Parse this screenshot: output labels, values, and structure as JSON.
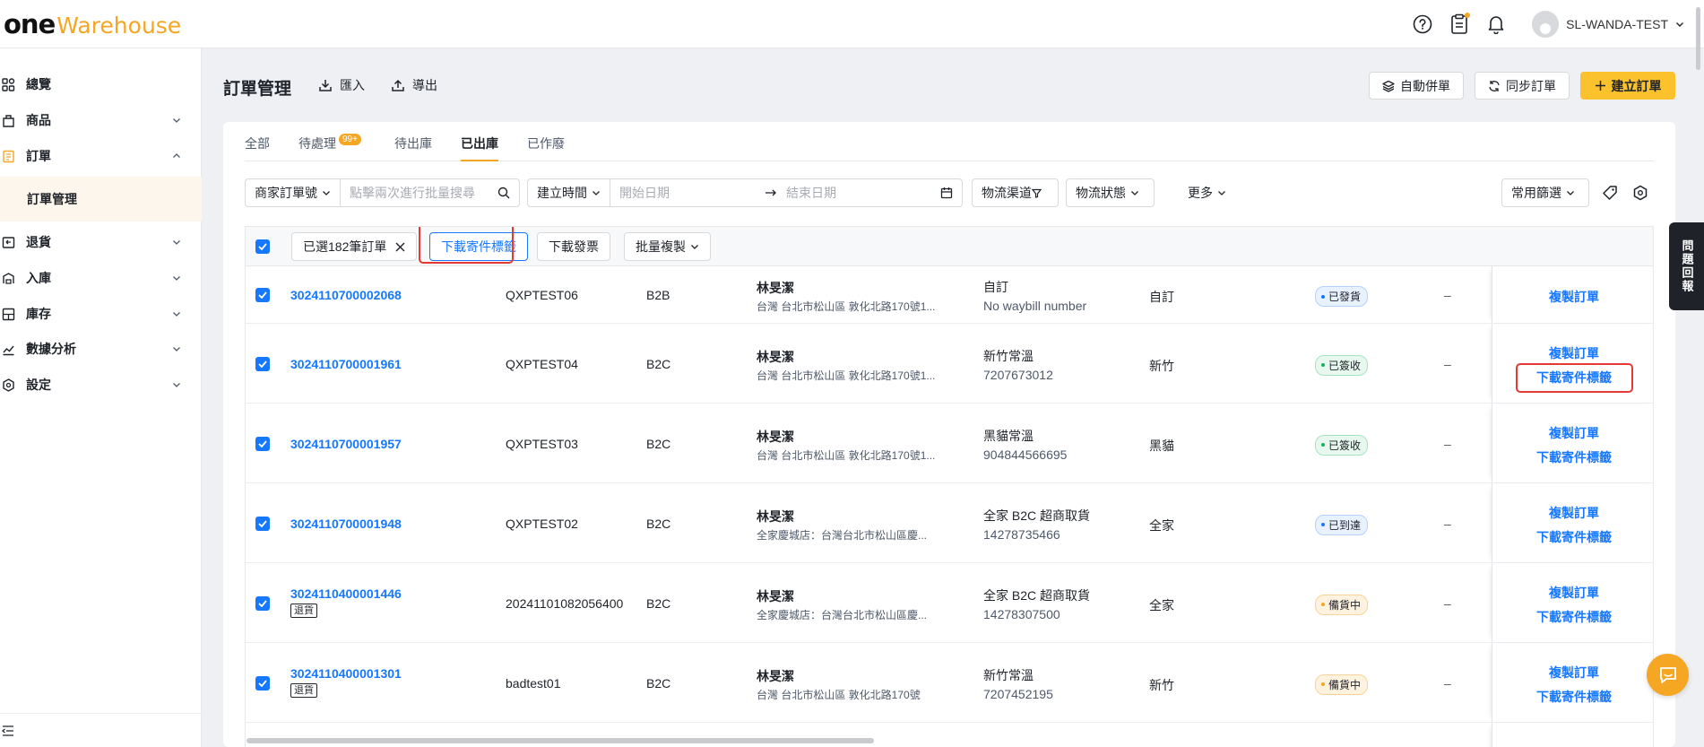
{
  "brand": {
    "part1": "one",
    "part2": "Warehouse"
  },
  "header": {
    "user_name": "SL-WANDA-TEST"
  },
  "sidebar": {
    "items": [
      {
        "label": "總覽",
        "icon": "dashboard-icon"
      },
      {
        "label": "商品",
        "icon": "product-icon"
      },
      {
        "label": "訂單",
        "icon": "order-icon"
      },
      {
        "label": "退貨",
        "icon": "return-icon"
      },
      {
        "label": "入庫",
        "icon": "inbound-icon"
      },
      {
        "label": "庫存",
        "icon": "inventory-icon"
      },
      {
        "label": "數據分析",
        "icon": "analytics-icon"
      },
      {
        "label": "設定",
        "icon": "settings-icon"
      }
    ],
    "active_sub": "訂單管理"
  },
  "page": {
    "title": "訂單管理",
    "import_label": "匯入",
    "export_label": "導出",
    "auto_merge_label": "自動併單",
    "sync_label": "同步訂單",
    "create_label": "建立訂單"
  },
  "tabs": [
    {
      "label": "全部"
    },
    {
      "label": "待處理",
      "badge": "99+"
    },
    {
      "label": "待出庫"
    },
    {
      "label": "已出庫"
    },
    {
      "label": "已作廢"
    }
  ],
  "filters": {
    "order_field": "商家訂單號",
    "search_placeholder": "點擊兩次進行批量搜尋",
    "time_field": "建立時間",
    "start_placeholder": "開始日期",
    "end_placeholder": "結束日期",
    "logistics_channel": "物流渠道",
    "logistics_status": "物流狀態",
    "more": "更多",
    "common_filter": "常用篩選"
  },
  "bulk": {
    "selected": "已選182筆訂單",
    "download_label": "下載寄件標籤",
    "download_invoice": "下載發票",
    "batch_copy": "批量複製"
  },
  "rows": [
    {
      "order_no": "3024110700002068",
      "merchant_no": "QXPTEST06",
      "type": "B2B",
      "name": "林旻潔",
      "addr": "台灣 台北市松山區 敦化北路170號1...",
      "ship_method": "自訂",
      "tracking": "No waybill number",
      "carrier": "自訂",
      "status": "已發貨",
      "status_color": "blue",
      "dash": "–",
      "actions": [
        "複製訂單"
      ],
      "returned": false
    },
    {
      "order_no": "3024110700001961",
      "merchant_no": "QXPTEST04",
      "type": "B2C",
      "name": "林旻潔",
      "addr": "台灣 台北市松山區 敦化北路170號1...",
      "ship_method": "新竹常溫",
      "tracking": "7207673012",
      "carrier": "新竹",
      "status": "已簽收",
      "status_color": "green",
      "dash": "–",
      "actions": [
        "複製訂單",
        "下載寄件標籤"
      ],
      "returned": false
    },
    {
      "order_no": "3024110700001957",
      "merchant_no": "QXPTEST03",
      "type": "B2C",
      "name": "林旻潔",
      "addr": "台灣 台北市松山區 敦化北路170號1...",
      "ship_method": "黑貓常溫",
      "tracking": "904844566695",
      "carrier": "黑貓",
      "status": "已簽收",
      "status_color": "green",
      "dash": "–",
      "actions": [
        "複製訂單",
        "下載寄件標籤"
      ],
      "returned": false
    },
    {
      "order_no": "3024110700001948",
      "merchant_no": "QXPTEST02",
      "type": "B2C",
      "name": "林旻潔",
      "addr": "全家慶城店：台灣台北市松山區慶...",
      "ship_method": "全家 B2C 超商取貨",
      "tracking": "14278735466",
      "carrier": "全家",
      "status": "已到達",
      "status_color": "blue",
      "dash": "–",
      "actions": [
        "複製訂單",
        "下載寄件標籤"
      ],
      "returned": false
    },
    {
      "order_no": "3024110400001446",
      "merchant_no": "20241101082056400",
      "type": "B2C",
      "name": "林旻潔",
      "addr": "全家慶城店：台灣台北市松山區慶...",
      "ship_method": "全家 B2C 超商取貨",
      "tracking": "14278307500",
      "carrier": "全家",
      "status": "備貨中",
      "status_color": "orange",
      "dash": "–",
      "actions": [
        "複製訂單",
        "下載寄件標籤"
      ],
      "returned": true,
      "return_tag": "退貨"
    },
    {
      "order_no": "3024110400001301",
      "merchant_no": "badtest01",
      "type": "B2C",
      "name": "林旻潔",
      "addr": "台灣 台北市松山區 敦化北路170號",
      "ship_method": "新竹常溫",
      "tracking": "7207452195",
      "carrier": "新竹",
      "status": "備貨中",
      "status_color": "orange",
      "dash": "–",
      "actions": [
        "複製訂單",
        "下載寄件標籤"
      ],
      "returned": true,
      "return_tag": "退貨"
    }
  ],
  "feedback": {
    "label": "問題回報"
  }
}
